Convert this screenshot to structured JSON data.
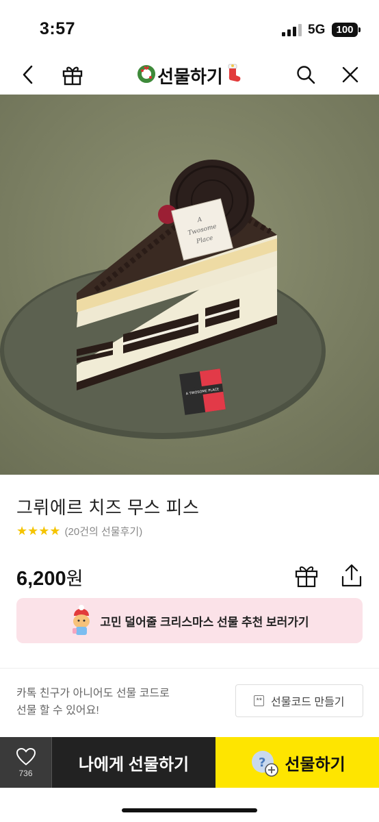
{
  "status_bar": {
    "time": "3:57",
    "network": "5G",
    "battery": "100"
  },
  "nav": {
    "title": "선물하기",
    "back_icon": "chevron-left-icon",
    "gift_icon": "gift-icon",
    "search_icon": "search-icon",
    "close_icon": "close-icon"
  },
  "hero": {
    "card_text_line1": "A",
    "card_text_line2": "Twosome",
    "card_text_line3": "Place",
    "sticker_text": "A TWOSOME PLACE"
  },
  "product": {
    "name": "그뤼에르 치즈 무스 피스",
    "stars": "★★★★",
    "star_rating": 4,
    "review_count": "(20건의 선물후기)",
    "price_number": "6,200",
    "price_unit": "원"
  },
  "promo": {
    "text": "고민 덜어줄 크리스마스 선물 추천 보러가기"
  },
  "gift_code": {
    "line1": "카톡 친구가 아니어도 선물 코드로",
    "line2": "선물 할 수 있어요!",
    "badge": "**",
    "button_label": "선물코드 만들기"
  },
  "bottom_bar": {
    "wish_count": "736",
    "self_gift_label": "나에게 선물하기",
    "gift_label": "선물하기"
  },
  "colors": {
    "accent_yellow": "#fee500",
    "promo_pink": "#fbe2e8",
    "star_yellow": "#f5c400",
    "bottom_dark": "#222222"
  }
}
